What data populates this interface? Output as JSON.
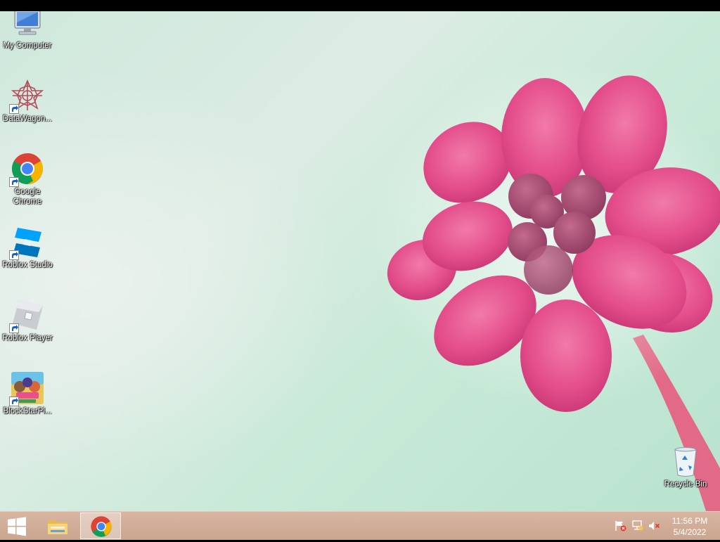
{
  "desktop": {
    "icons": [
      {
        "label": "My Computer",
        "icon": "computer-icon"
      },
      {
        "label": "DataWagon...",
        "icon": "datawagon-icon"
      },
      {
        "label": "Google Chrome",
        "icon": "chrome-icon"
      },
      {
        "label": "Roblox Studio",
        "icon": "roblox-studio-icon"
      },
      {
        "label": "Roblox Player",
        "icon": "roblox-player-icon"
      },
      {
        "label": "BlockStarPl...",
        "icon": "blockstar-icon"
      }
    ],
    "recycle_bin": {
      "label": "Recycle Bin",
      "icon": "recycle-bin-icon"
    }
  },
  "taskbar": {
    "start": {
      "icon": "windows-logo-icon"
    },
    "pinned": [
      {
        "name": "File Explorer",
        "icon": "folder-icon"
      },
      {
        "name": "Google Chrome",
        "icon": "chrome-icon",
        "active": true
      }
    ],
    "tray": [
      {
        "icon": "action-center-flag-icon"
      },
      {
        "icon": "network-icon"
      },
      {
        "icon": "volume-muted-icon"
      }
    ],
    "clock": {
      "time": "11:56 PM",
      "date": "5/4/2022"
    }
  },
  "colors": {
    "taskbar": "#caa58f",
    "flower": "#e8508f",
    "chrome_red": "#db4437",
    "chrome_yellow": "#f4b400",
    "chrome_green": "#0f9d58",
    "chrome_blue": "#4285f4"
  }
}
